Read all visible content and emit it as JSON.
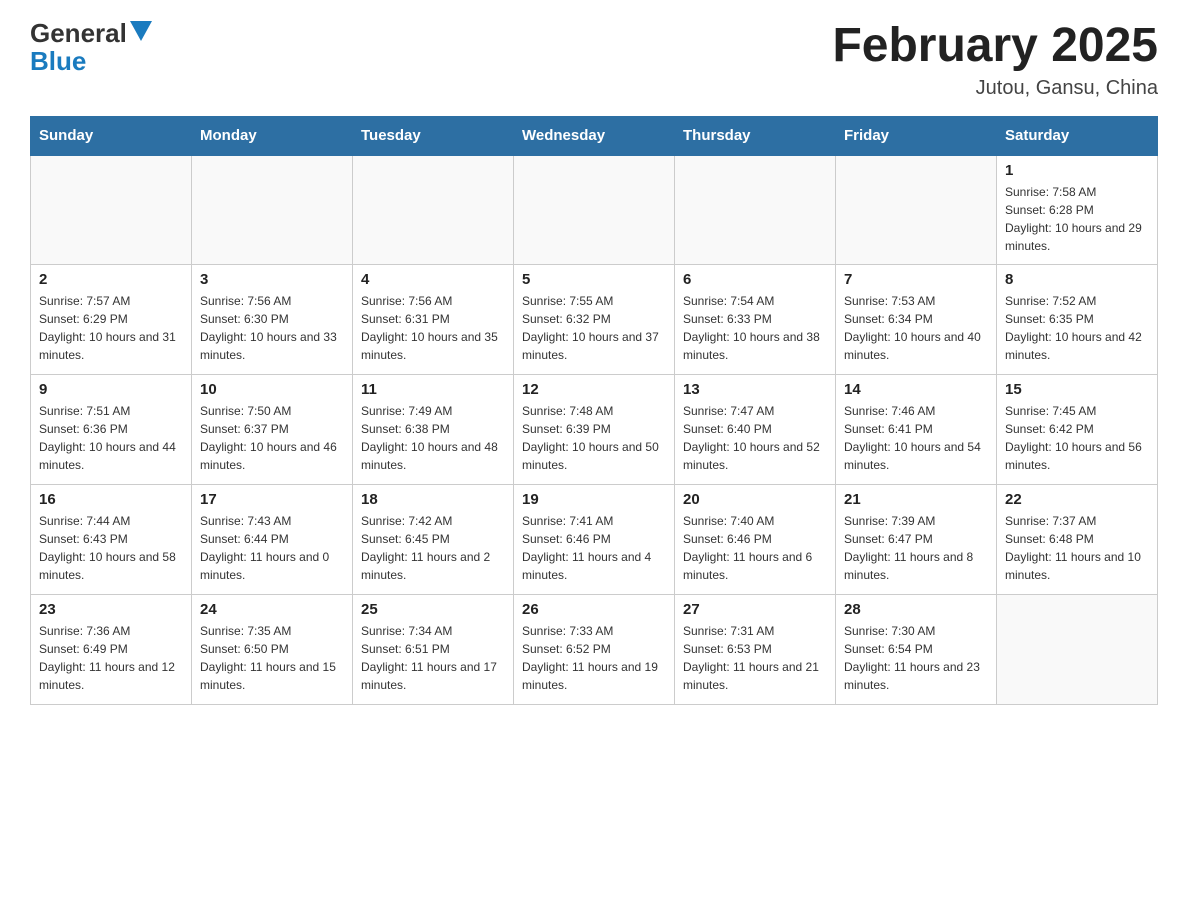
{
  "logo": {
    "text1": "General",
    "text2": "Blue"
  },
  "title": "February 2025",
  "location": "Jutou, Gansu, China",
  "days_of_week": [
    "Sunday",
    "Monday",
    "Tuesday",
    "Wednesday",
    "Thursday",
    "Friday",
    "Saturday"
  ],
  "weeks": [
    [
      {
        "day": "",
        "info": ""
      },
      {
        "day": "",
        "info": ""
      },
      {
        "day": "",
        "info": ""
      },
      {
        "day": "",
        "info": ""
      },
      {
        "day": "",
        "info": ""
      },
      {
        "day": "",
        "info": ""
      },
      {
        "day": "1",
        "info": "Sunrise: 7:58 AM\nSunset: 6:28 PM\nDaylight: 10 hours and 29 minutes."
      }
    ],
    [
      {
        "day": "2",
        "info": "Sunrise: 7:57 AM\nSunset: 6:29 PM\nDaylight: 10 hours and 31 minutes."
      },
      {
        "day": "3",
        "info": "Sunrise: 7:56 AM\nSunset: 6:30 PM\nDaylight: 10 hours and 33 minutes."
      },
      {
        "day": "4",
        "info": "Sunrise: 7:56 AM\nSunset: 6:31 PM\nDaylight: 10 hours and 35 minutes."
      },
      {
        "day": "5",
        "info": "Sunrise: 7:55 AM\nSunset: 6:32 PM\nDaylight: 10 hours and 37 minutes."
      },
      {
        "day": "6",
        "info": "Sunrise: 7:54 AM\nSunset: 6:33 PM\nDaylight: 10 hours and 38 minutes."
      },
      {
        "day": "7",
        "info": "Sunrise: 7:53 AM\nSunset: 6:34 PM\nDaylight: 10 hours and 40 minutes."
      },
      {
        "day": "8",
        "info": "Sunrise: 7:52 AM\nSunset: 6:35 PM\nDaylight: 10 hours and 42 minutes."
      }
    ],
    [
      {
        "day": "9",
        "info": "Sunrise: 7:51 AM\nSunset: 6:36 PM\nDaylight: 10 hours and 44 minutes."
      },
      {
        "day": "10",
        "info": "Sunrise: 7:50 AM\nSunset: 6:37 PM\nDaylight: 10 hours and 46 minutes."
      },
      {
        "day": "11",
        "info": "Sunrise: 7:49 AM\nSunset: 6:38 PM\nDaylight: 10 hours and 48 minutes."
      },
      {
        "day": "12",
        "info": "Sunrise: 7:48 AM\nSunset: 6:39 PM\nDaylight: 10 hours and 50 minutes."
      },
      {
        "day": "13",
        "info": "Sunrise: 7:47 AM\nSunset: 6:40 PM\nDaylight: 10 hours and 52 minutes."
      },
      {
        "day": "14",
        "info": "Sunrise: 7:46 AM\nSunset: 6:41 PM\nDaylight: 10 hours and 54 minutes."
      },
      {
        "day": "15",
        "info": "Sunrise: 7:45 AM\nSunset: 6:42 PM\nDaylight: 10 hours and 56 minutes."
      }
    ],
    [
      {
        "day": "16",
        "info": "Sunrise: 7:44 AM\nSunset: 6:43 PM\nDaylight: 10 hours and 58 minutes."
      },
      {
        "day": "17",
        "info": "Sunrise: 7:43 AM\nSunset: 6:44 PM\nDaylight: 11 hours and 0 minutes."
      },
      {
        "day": "18",
        "info": "Sunrise: 7:42 AM\nSunset: 6:45 PM\nDaylight: 11 hours and 2 minutes."
      },
      {
        "day": "19",
        "info": "Sunrise: 7:41 AM\nSunset: 6:46 PM\nDaylight: 11 hours and 4 minutes."
      },
      {
        "day": "20",
        "info": "Sunrise: 7:40 AM\nSunset: 6:46 PM\nDaylight: 11 hours and 6 minutes."
      },
      {
        "day": "21",
        "info": "Sunrise: 7:39 AM\nSunset: 6:47 PM\nDaylight: 11 hours and 8 minutes."
      },
      {
        "day": "22",
        "info": "Sunrise: 7:37 AM\nSunset: 6:48 PM\nDaylight: 11 hours and 10 minutes."
      }
    ],
    [
      {
        "day": "23",
        "info": "Sunrise: 7:36 AM\nSunset: 6:49 PM\nDaylight: 11 hours and 12 minutes."
      },
      {
        "day": "24",
        "info": "Sunrise: 7:35 AM\nSunset: 6:50 PM\nDaylight: 11 hours and 15 minutes."
      },
      {
        "day": "25",
        "info": "Sunrise: 7:34 AM\nSunset: 6:51 PM\nDaylight: 11 hours and 17 minutes."
      },
      {
        "day": "26",
        "info": "Sunrise: 7:33 AM\nSunset: 6:52 PM\nDaylight: 11 hours and 19 minutes."
      },
      {
        "day": "27",
        "info": "Sunrise: 7:31 AM\nSunset: 6:53 PM\nDaylight: 11 hours and 21 minutes."
      },
      {
        "day": "28",
        "info": "Sunrise: 7:30 AM\nSunset: 6:54 PM\nDaylight: 11 hours and 23 minutes."
      },
      {
        "day": "",
        "info": ""
      }
    ]
  ]
}
